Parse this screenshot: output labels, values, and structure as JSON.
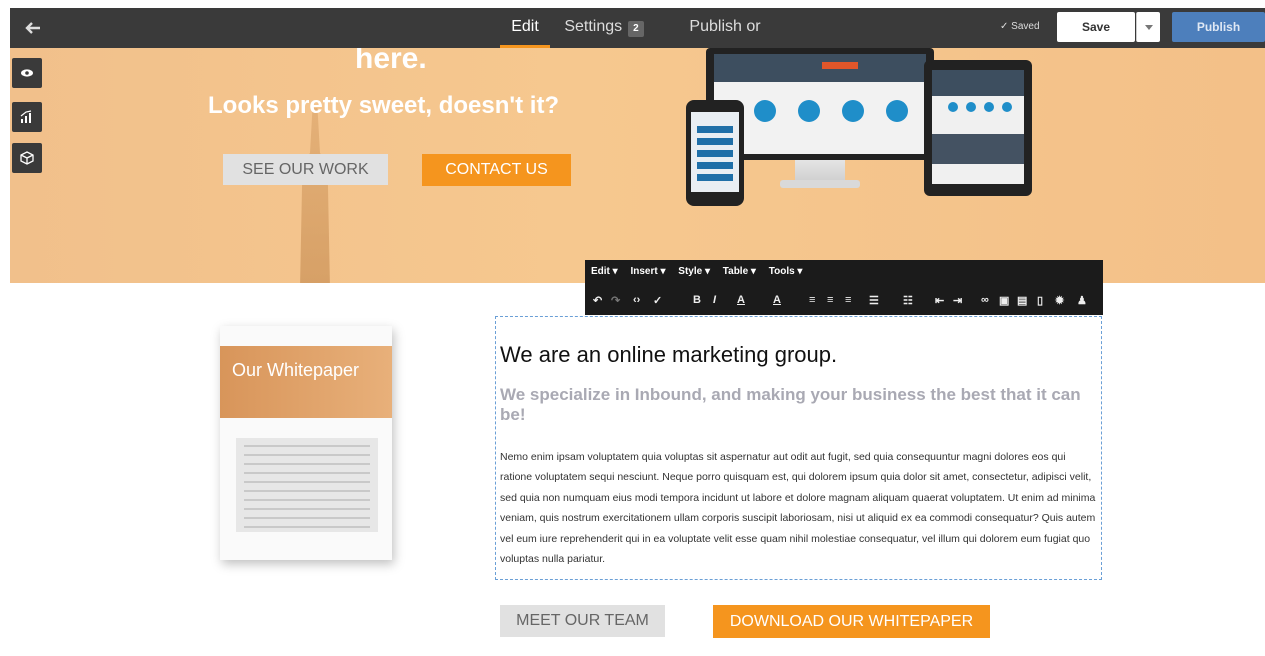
{
  "topbar": {
    "tabs": [
      {
        "label": "Edit",
        "active": true
      },
      {
        "label": "Settings",
        "badge": "2"
      },
      {
        "label": "Publish or Schedule"
      }
    ],
    "saved_status": "✓ Saved",
    "save_label": "Save",
    "publish_label": "Publish"
  },
  "hero": {
    "heading_partial": "here.",
    "subheading": "Looks pretty sweet, doesn't it?",
    "see_work_label": "SEE OUR WORK",
    "contact_label": "CONTACT US"
  },
  "editor": {
    "menus": [
      "Edit ▾",
      "Insert ▾",
      "Style ▾",
      "Table ▾",
      "Tools ▾"
    ]
  },
  "whitepaper": {
    "title": "Our Whitepaper"
  },
  "content": {
    "heading": "We are an online marketing group.",
    "subheading": "We specialize in Inbound, and making your business the best that it can be!",
    "body": "Nemo enim ipsam voluptatem quia voluptas sit aspernatur aut odit aut fugit, sed quia consequuntur magni dolores eos qui ratione voluptatem sequi nesciunt. Neque porro quisquam est, qui dolorem ipsum quia dolor sit amet, consectetur, adipisci velit, sed quia non numquam eius modi tempora incidunt ut labore et dolore magnam aliquam quaerat voluptatem. Ut enim ad minima veniam, quis nostrum exercitationem ullam corporis suscipit laboriosam, nisi ut aliquid ex ea commodi consequatur? Quis autem vel eum iure reprehenderit qui in ea voluptate velit esse quam nihil molestiae consequatur, vel illum qui dolorem eum fugiat quo voluptas nulla pariatur.",
    "meet_team_label": "MEET OUR TEAM",
    "download_label": "DOWNLOAD OUR WHITEPAPER"
  },
  "colors": {
    "accent_orange": "#f5951e",
    "publish_blue": "#4d7fbc",
    "toolbar_dark": "#3a3a3a"
  }
}
